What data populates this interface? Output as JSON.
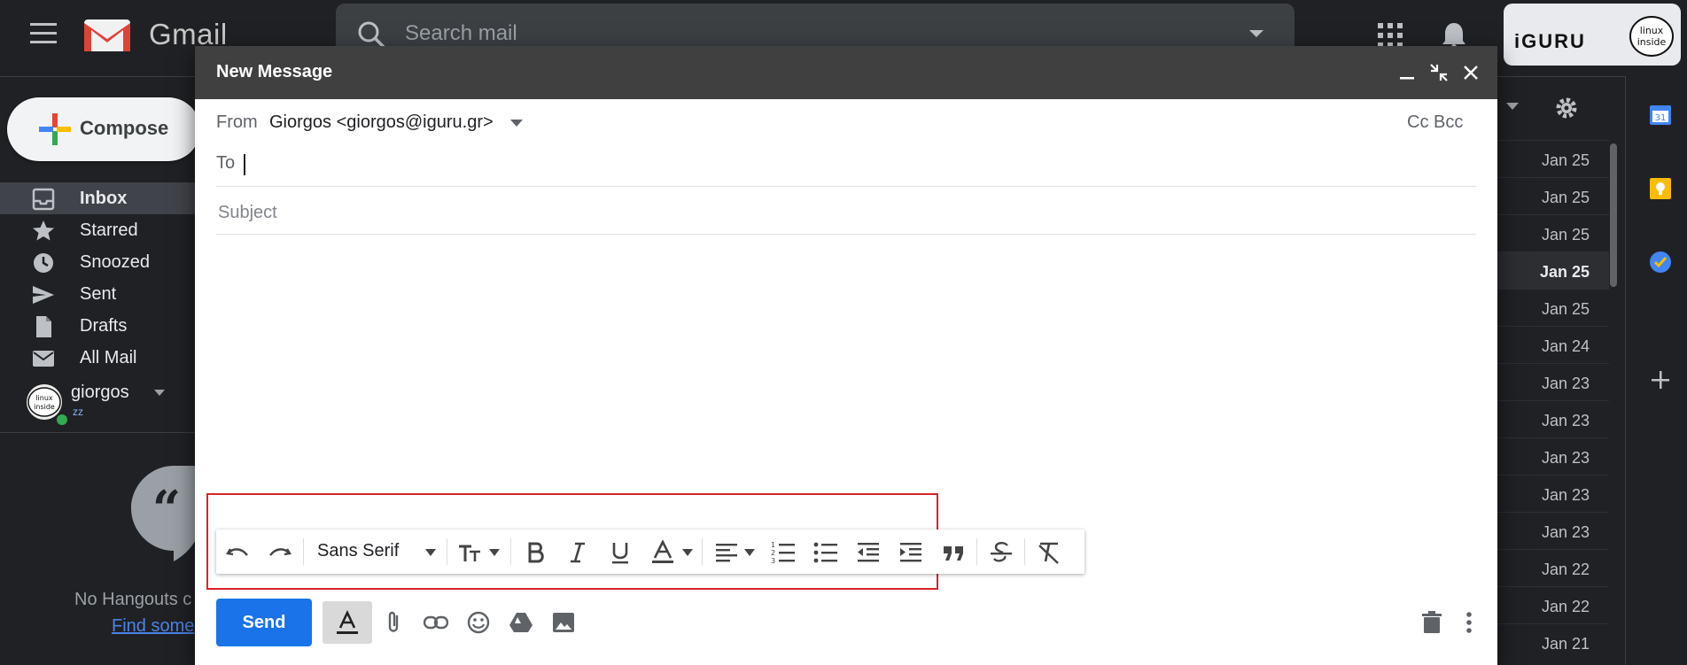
{
  "app": {
    "name": "Gmail"
  },
  "search": {
    "placeholder": "Search mail"
  },
  "account": {
    "badge_text": "iGURU",
    "logo_text": "linux inside"
  },
  "sidebar": {
    "compose_label": "Compose",
    "items": [
      {
        "label": "Inbox",
        "icon": "inbox-icon",
        "active": true
      },
      {
        "label": "Starred",
        "icon": "star-icon"
      },
      {
        "label": "Snoozed",
        "icon": "clock-icon"
      },
      {
        "label": "Sent",
        "icon": "send-icon"
      },
      {
        "label": "Drafts",
        "icon": "file-icon"
      },
      {
        "label": "All Mail",
        "icon": "mail-icon"
      }
    ]
  },
  "hangouts": {
    "user": "giorgos",
    "status": "zz",
    "empty_text": "No Hangouts c",
    "find_link": "Find some"
  },
  "message_list": {
    "dates": [
      "Jan 25",
      "Jan 25",
      "Jan 25",
      "Jan 25",
      "Jan 25",
      "Jan 24",
      "Jan 23",
      "Jan 23",
      "Jan 23",
      "Jan 23",
      "Jan 23",
      "Jan 22",
      "Jan 22",
      "Jan 21"
    ],
    "highlighted_index": 3
  },
  "compose": {
    "title": "New Message",
    "from_label": "From",
    "from_value": "Giorgos <giorgos@iguru.gr>",
    "cc_bcc": "Cc Bcc",
    "to_label": "To",
    "to_value": "",
    "subject_placeholder": "Subject",
    "body": "",
    "font_name": "Sans Serif",
    "send_label": "Send"
  },
  "colors": {
    "header_bg": "#404040",
    "send_blue": "#1a73e8",
    "highlight_red": "#d8232a",
    "dark_bg": "#202124"
  }
}
